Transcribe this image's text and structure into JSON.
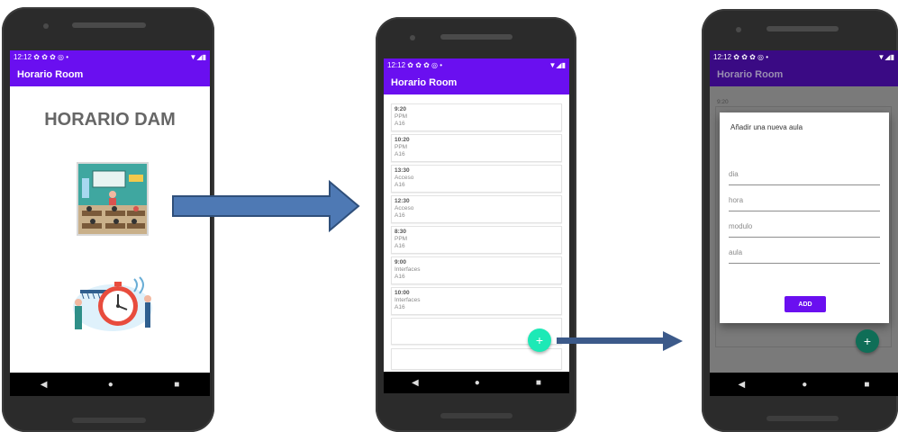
{
  "status": {
    "time": "12:12",
    "icons": "✿ ✿ ✿ ◎ •",
    "signal": "▼◢▮"
  },
  "app": {
    "title": "Horario Room",
    "primary": "#6a0ff0",
    "dim_primary": "#3a0a84"
  },
  "screen1": {
    "heading": "HORARIO DAM",
    "image1_icon": "classroom-illustration",
    "image2_icon": "stopwatch-illustration"
  },
  "screen2": {
    "items": [
      {
        "hora": "9:20",
        "modulo": "PPM",
        "aula": "A16"
      },
      {
        "hora": "10:20",
        "modulo": "PPM",
        "aula": "A16"
      },
      {
        "hora": "13:30",
        "modulo": "Acceso",
        "aula": "A16"
      },
      {
        "hora": "12:30",
        "modulo": "Acceso",
        "aula": "A16"
      },
      {
        "hora": "8:30",
        "modulo": "PPM",
        "aula": "A16"
      },
      {
        "hora": "9:00",
        "modulo": "Interfaces",
        "aula": "A16"
      },
      {
        "hora": "10:00",
        "modulo": "Interfaces",
        "aula": "A16"
      }
    ],
    "fab_label": "+",
    "fab_color": "#1de9b6"
  },
  "screen3": {
    "behind_first": "9:20",
    "dialog_title": "Añadir una nueva aula",
    "fields": {
      "dia": "dia",
      "hora": "hora",
      "modulo": "modulo",
      "aula": "aula"
    },
    "add_button": "ADD",
    "fab_label": "+"
  },
  "nav": {
    "back": "◀",
    "home": "●",
    "recents": "■"
  }
}
